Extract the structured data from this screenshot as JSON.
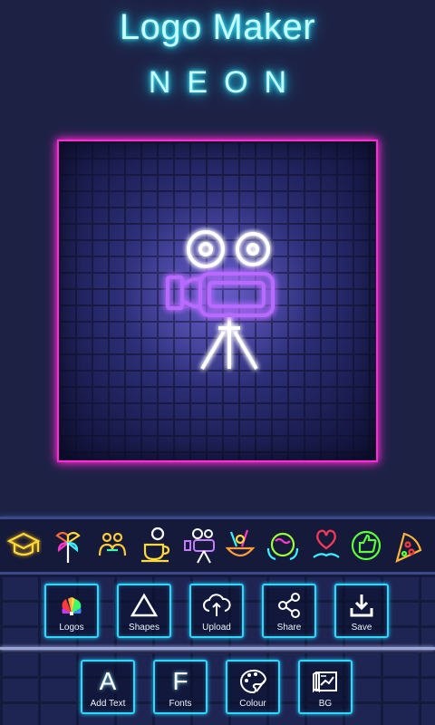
{
  "app": {
    "title": "Logo Maker",
    "subtitle": "NEON"
  },
  "canvas": {
    "selected_logo": "camera-icon",
    "border_color": "#ff2bd6",
    "glow_color": "#8f5bff"
  },
  "logo_strip": {
    "icons": [
      "graduation-cap-icon",
      "pinwheel-icon",
      "handshake-icon",
      "coffee-cup-icon",
      "camera-icon",
      "food-basket-icon",
      "globe-hands-icon",
      "heart-hand-icon",
      "thumbs-up-icon",
      "pizza-icon"
    ]
  },
  "toolbar_top": [
    {
      "label": "Logos",
      "icon": "peacock-icon"
    },
    {
      "label": "Shapes",
      "icon": "triangle-icon"
    },
    {
      "label": "Upload",
      "icon": "cloud-upload-icon"
    },
    {
      "label": "Share",
      "icon": "share-icon"
    },
    {
      "label": "Save",
      "icon": "download-icon"
    }
  ],
  "toolbar_bottom": [
    {
      "label": "Add Text",
      "icon": "letter-a-icon",
      "glyph": "A"
    },
    {
      "label": "Fonts",
      "icon": "letter-f-icon",
      "glyph": "F"
    },
    {
      "label": "Colour",
      "icon": "palette-icon"
    },
    {
      "label": "BG",
      "icon": "background-icon"
    }
  ],
  "colors": {
    "accent_cyan": "#2fd8ff",
    "background": "#1d2245"
  }
}
